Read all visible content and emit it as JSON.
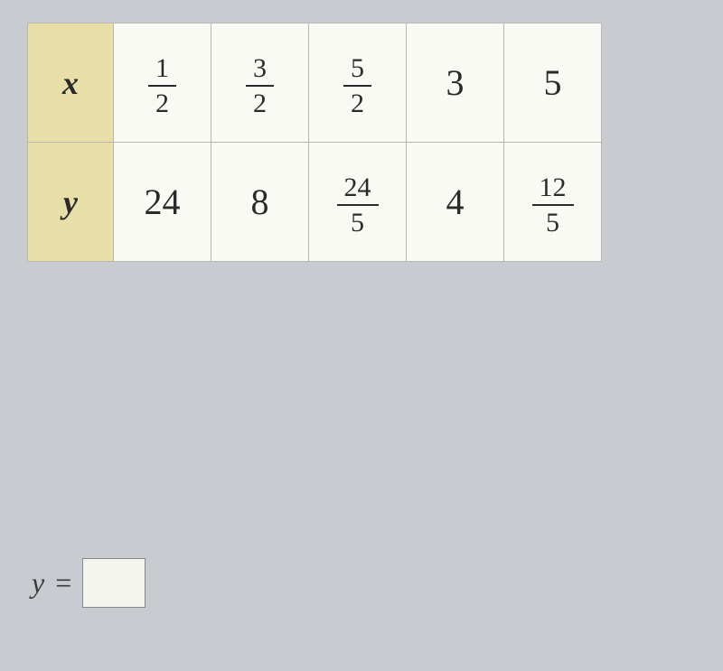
{
  "table": {
    "rows": [
      {
        "header": "x",
        "cells": [
          {
            "type": "fraction",
            "num": "1",
            "den": "2"
          },
          {
            "type": "fraction",
            "num": "3",
            "den": "2"
          },
          {
            "type": "fraction",
            "num": "5",
            "den": "2"
          },
          {
            "type": "whole",
            "value": "3"
          },
          {
            "type": "whole",
            "value": "5"
          }
        ]
      },
      {
        "header": "y",
        "cells": [
          {
            "type": "whole",
            "value": "24"
          },
          {
            "type": "whole",
            "value": "8"
          },
          {
            "type": "fraction",
            "num": "24",
            "den": "5"
          },
          {
            "type": "whole",
            "value": "4"
          },
          {
            "type": "fraction",
            "num": "12",
            "den": "5"
          }
        ]
      }
    ]
  },
  "equation": {
    "variable": "y",
    "operator": "=",
    "input_value": ""
  }
}
